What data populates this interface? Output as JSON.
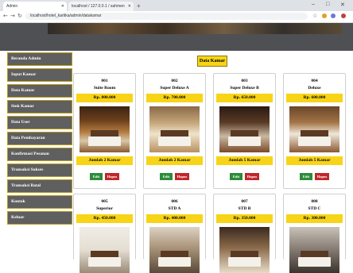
{
  "browser": {
    "tabs": [
      {
        "label": "Admin",
        "active": true
      },
      {
        "label": "localhost / 127.0.0.1 / sahmen",
        "active": false
      }
    ],
    "url": "localhost/hotel_kartika/admin/datakamar"
  },
  "sidebar": {
    "items": [
      {
        "label": "Beranda Admin"
      },
      {
        "label": "Input Kamar"
      },
      {
        "label": "Data Kamar"
      },
      {
        "label": "Stok Kamar"
      },
      {
        "label": "Data User"
      },
      {
        "label": "Data Pembayaran"
      },
      {
        "label": "Konfirmasi Pesanan"
      },
      {
        "label": "Transaksi Sukses"
      },
      {
        "label": "Transaksi Batal"
      },
      {
        "label": "Kontak"
      },
      {
        "label": "Keluar"
      }
    ]
  },
  "main": {
    "title": "Data Kamar",
    "edit_label": "Edit",
    "delete_label": "Hapus",
    "rooms": [
      {
        "number": "001",
        "name": "Suite Room",
        "price": "Rp. 800.000",
        "stock": "Jumlah 2 Kamar"
      },
      {
        "number": "002",
        "name": "Super Deluxe A",
        "price": "Rp. 700.000",
        "stock": "Jumlah 2 Kamar"
      },
      {
        "number": "003",
        "name": "Super Deluxe B",
        "price": "Rp. 650.000",
        "stock": "Jumlah 5 Kamar"
      },
      {
        "number": "004",
        "name": "Deluxe",
        "price": "Rp. 600.000",
        "stock": "Jumlah 5 Kamar"
      },
      {
        "number": "005",
        "name": "Superior",
        "price": "Rp. 450.000",
        "stock": ""
      },
      {
        "number": "006",
        "name": "STD A",
        "price": "Rp. 400.000",
        "stock": ""
      },
      {
        "number": "007",
        "name": "STD B",
        "price": "Rp. 350.000",
        "stock": ""
      },
      {
        "number": "008",
        "name": "STD C",
        "price": "Rp. 300.000",
        "stock": ""
      }
    ]
  },
  "colors": {
    "accent": "#f7d417",
    "sidebar": "#5f5f5f",
    "edit": "#2e8b3a",
    "delete": "#c0262b"
  }
}
